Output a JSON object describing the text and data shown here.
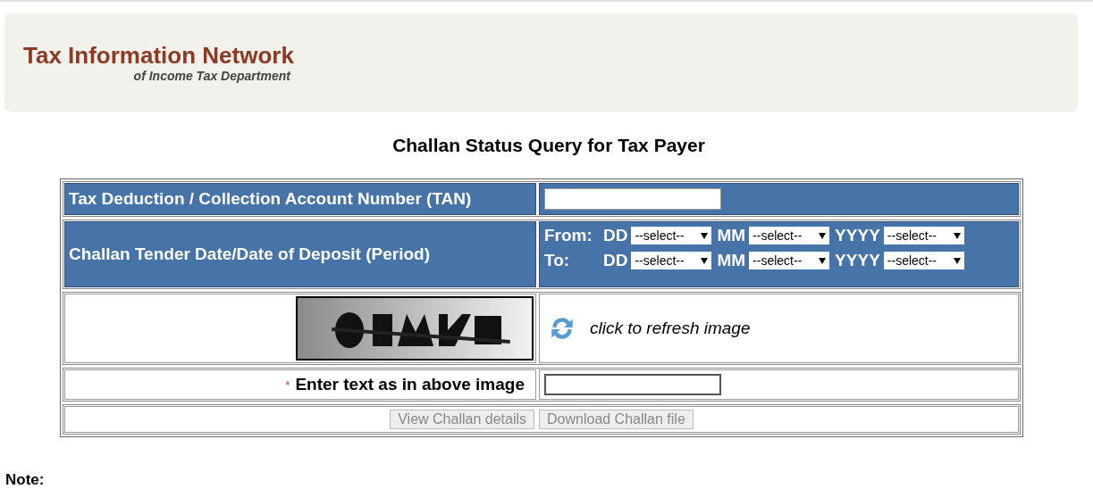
{
  "header": {
    "title": "Tax Information Network",
    "subtitle": "of Income Tax Department"
  },
  "page_title": "Challan Status Query for Tax Payer",
  "tan_row": {
    "label": "Tax Deduction / Collection Account Number (TAN)"
  },
  "date_row": {
    "label": "Challan Tender Date/Date of Deposit (Period)",
    "ranges": [
      {
        "label": "From:",
        "fields": [
          {
            "label": "DD",
            "value": "--select--"
          },
          {
            "label": "MM",
            "value": "--select--"
          },
          {
            "label": "YYYY",
            "value": "--select--"
          }
        ]
      },
      {
        "label": "To:",
        "fields": [
          {
            "label": "DD",
            "value": "--select--"
          },
          {
            "label": "MM",
            "value": "--select--"
          },
          {
            "label": "YYYY",
            "value": "--select--"
          }
        ]
      }
    ]
  },
  "captcha_row": {
    "refresh_text": "click to refresh image"
  },
  "answer_row": {
    "required_mark": "*",
    "label": "Enter text as in above image"
  },
  "buttons": [
    {
      "label": "View Challan details",
      "disabled": true
    },
    {
      "label": "Download Challan file",
      "disabled": true
    }
  ],
  "note": {
    "title": "Note:"
  }
}
